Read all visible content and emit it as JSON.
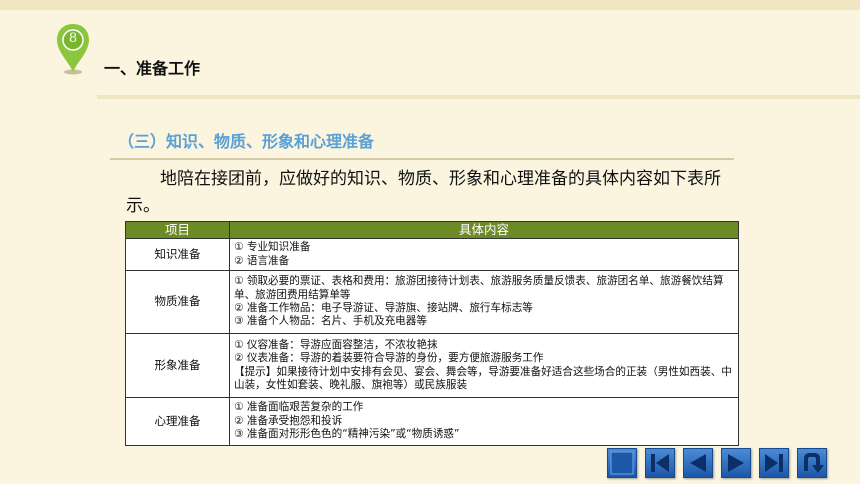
{
  "header": {
    "slide_number": "8",
    "title": "一、准备工作"
  },
  "section": {
    "heading": "（三）知识、物质、形象和心理准备"
  },
  "intro": "地陪在接团前，应做好的知识、物质、形象和心理准备的具体内容如下表所示。",
  "table": {
    "headers": [
      "项目",
      "具体内容"
    ],
    "rows": [
      {
        "category": "知识准备",
        "lines": [
          "① 专业知识准备",
          "② 语言准备"
        ]
      },
      {
        "category": "物质准备",
        "lines": [
          "① 领取必要的票证、表格和费用：旅游团接待计划表、旅游服务质量反馈表、旅游团名单、旅游餐饮结算单、旅游团费用结算单等",
          "② 准备工作物品：电子导游证、导游旗、接站牌、旅行车标志等",
          "③ 准备个人物品：名片、手机及充电器等"
        ]
      },
      {
        "category": "形象准备",
        "lines": [
          "① 仪容准备：导游应面容整洁，不浓妆艳抹",
          "② 仪表准备：导游的着装要符合导游的身份，要方便旅游服务工作",
          "【提示】如果接待计划中安排有会见、宴会、舞会等，导游要准备好适合这些场合的正装（男性如西装、中山装，女性如套装、晚礼服、旗袍等）或民族服装"
        ]
      },
      {
        "category": "心理准备",
        "lines": [
          "① 准备面临艰苦复杂的工作",
          "② 准备承受抱怨和投诉",
          "③ 准备面对形形色色的“精神污染”或“物质诱惑”"
        ]
      }
    ]
  },
  "nav": {
    "buttons": [
      "stop-icon",
      "first-slide-icon",
      "previous-slide-icon",
      "next-slide-icon",
      "last-slide-icon",
      "return-icon"
    ]
  },
  "colors": {
    "background": "#fbf5e0",
    "pin": "#8cc63f",
    "section_heading": "#5aa0d8",
    "table_header": "#6c8a26",
    "nav_button": "#2a6cc0"
  }
}
